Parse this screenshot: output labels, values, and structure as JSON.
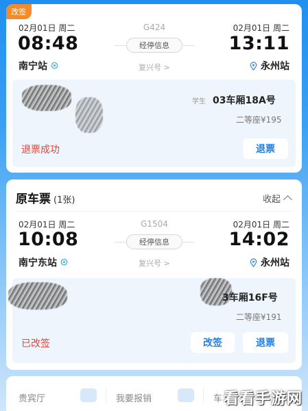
{
  "ticket1": {
    "badge": "改签",
    "dep_date": "02月01日 周二",
    "arr_date": "02月01日 周二",
    "dep_time": "08:48",
    "arr_time": "13:11",
    "dep_station": "南宁站",
    "arr_station": "永州站",
    "train_no": "G424",
    "stops_label": "经停信息",
    "train_type": "复兴号 >",
    "passenger_tag": "学生",
    "seat": "03车厢18A号",
    "seat_class": "二等座¥195",
    "status": "退票成功",
    "refund_label": "退票"
  },
  "ticket2": {
    "section_title": "原车票",
    "section_count": "(1张)",
    "collapse_label": "收起",
    "dep_date": "02月01日 周二",
    "arr_date": "02月01日 周二",
    "dep_time": "10:08",
    "arr_time": "14:02",
    "dep_station": "南宁东站",
    "arr_station": "永州站",
    "train_no": "G1504",
    "stops_label": "经停信息",
    "train_type": "复兴号 >",
    "seat": "3车厢16F号",
    "seat_class": "二等座¥191",
    "status": "已改签",
    "change_label": "改签",
    "refund_label": "退票"
  },
  "bottom": {
    "item1": "贵宾厅",
    "item2": "我要报销",
    "item3": "车"
  },
  "watermark": "看看手游网",
  "colors": {
    "accent": "#1f7ee8",
    "status_red": "#e0463a",
    "badge_orange": "#f38b2a"
  }
}
